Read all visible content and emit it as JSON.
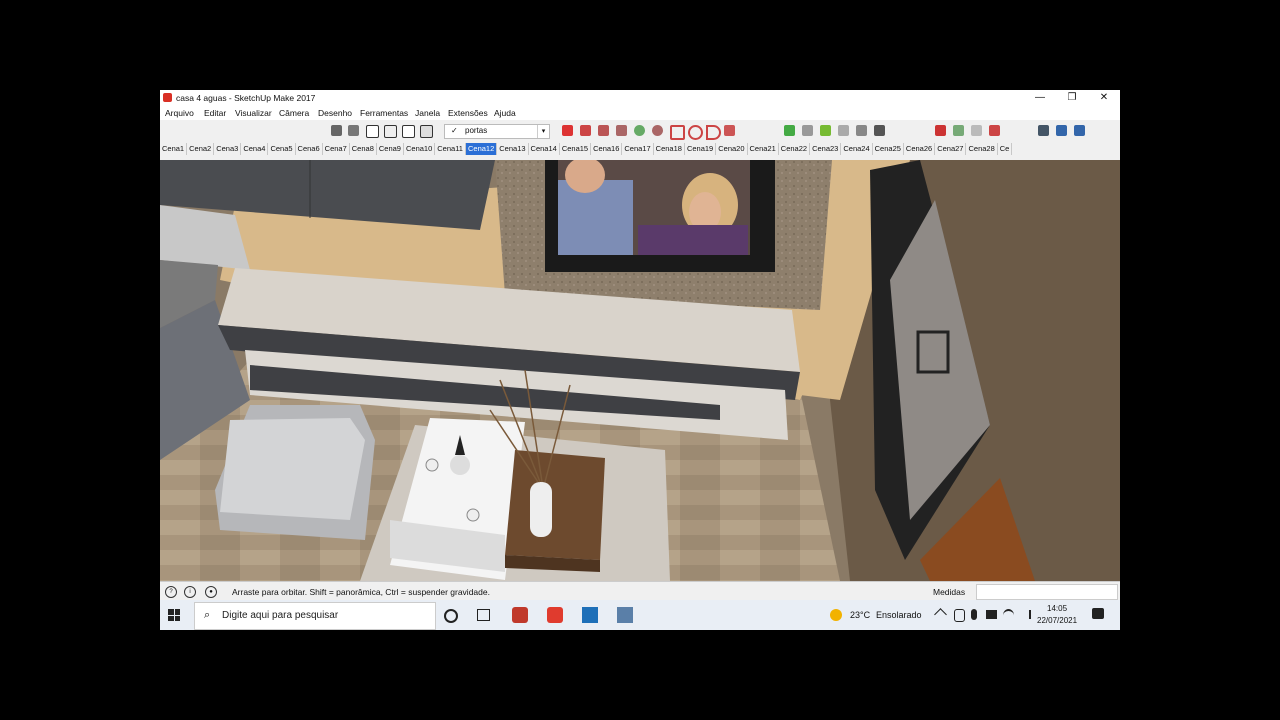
{
  "window": {
    "title": "casa 4 aguas - SketchUp Make 2017",
    "minimize_glyph": "—",
    "maximize_glyph": "❐",
    "close_glyph": "✕"
  },
  "menu": [
    "Arquivo",
    "Editar",
    "Visualizar",
    "Câmera",
    "Desenho",
    "Ferramentas",
    "Janela",
    "Extensões",
    "Ajuda"
  ],
  "layer": {
    "check": "✓",
    "value": "portas",
    "arrow": "▾"
  },
  "scenes": [
    "Cena1",
    "Cena2",
    "Cena3",
    "Cena4",
    "Cena5",
    "Cena6",
    "Cena7",
    "Cena8",
    "Cena9",
    "Cena10",
    "Cena11",
    "Cena12",
    "Cena13",
    "Cena14",
    "Cena15",
    "Cena16",
    "Cena17",
    "Cena18",
    "Cena19",
    "Cena20",
    "Cena21",
    "Cena22",
    "Cena23",
    "Cena24",
    "Cena25",
    "Cena26",
    "Cena27",
    "Cena28",
    "Ce"
  ],
  "active_scene_index": 11,
  "status": {
    "text": "Arraste para orbitar. Shift = panorâmica, Ctrl = suspender gravidade.",
    "measure_label": "Medidas",
    "info_glyph": "?",
    "geo_glyph": "i",
    "user_glyph": "●"
  },
  "taskbar": {
    "search_placeholder": "Digite aqui para pesquisar",
    "search_glyph": "⌕",
    "temperature": "23°C",
    "weather": "Ensolarado",
    "time": "14:05",
    "date": "22/07/2021"
  },
  "colors": {
    "accent": "#2b6fd6",
    "sketchup_red": "#d93025",
    "wall": "#d8b98a",
    "floor": "#a8957c"
  }
}
